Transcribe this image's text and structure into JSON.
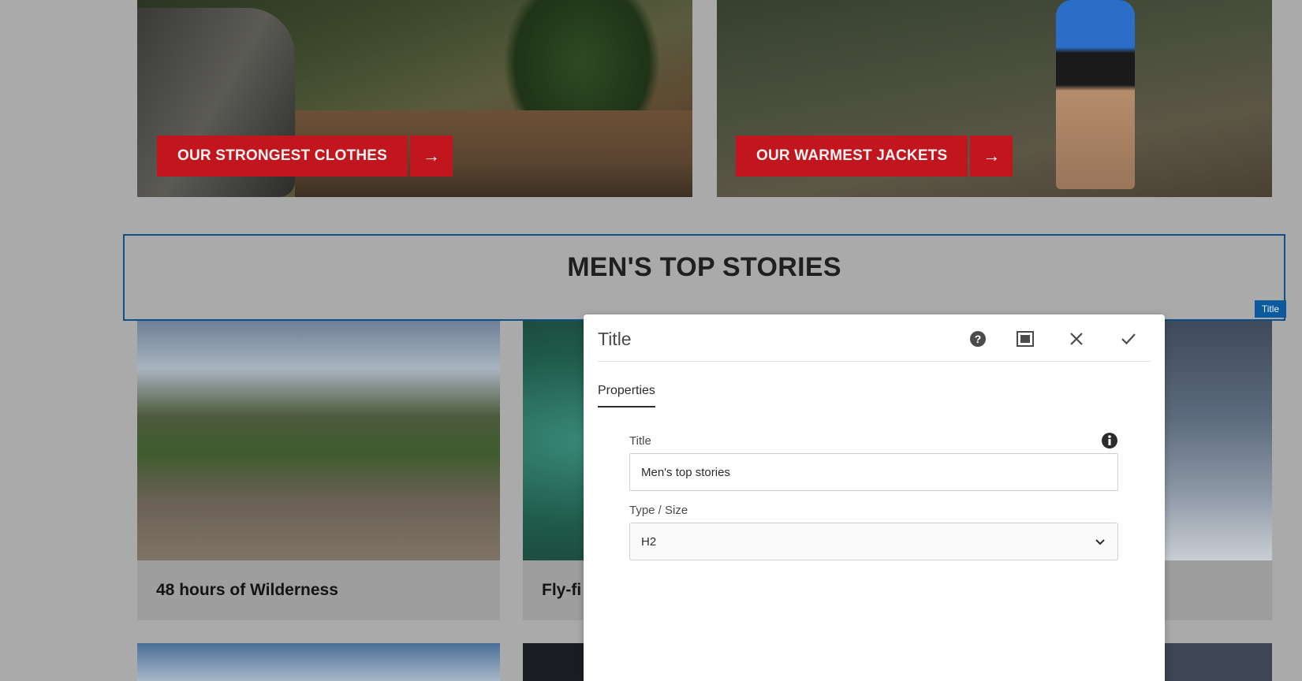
{
  "promos": [
    {
      "label": "OUR STRONGEST CLOTHES",
      "arrow": "→"
    },
    {
      "label": "OUR WARMEST JACKETS",
      "arrow": "→"
    }
  ],
  "section": {
    "heading": "MEN'S TOP STORIES",
    "component_tag": "Title"
  },
  "stories": [
    {
      "caption": "48 hours of Wilderness"
    },
    {
      "caption": "Fly-fi"
    },
    {
      "caption": ""
    }
  ],
  "dialog": {
    "title": "Title",
    "icons": {
      "help": "help-icon",
      "fullscreen": "fullscreen-icon",
      "close": "close-icon",
      "confirm": "check-icon"
    },
    "tabs": [
      {
        "label": "Properties",
        "active": true
      }
    ],
    "fields": {
      "title_label": "Title",
      "title_value": "Men's top stories",
      "type_label": "Type / Size",
      "type_value": "H2"
    }
  },
  "colors": {
    "accent_red": "#c2161f",
    "editor_blue": "#0c4f8a"
  }
}
